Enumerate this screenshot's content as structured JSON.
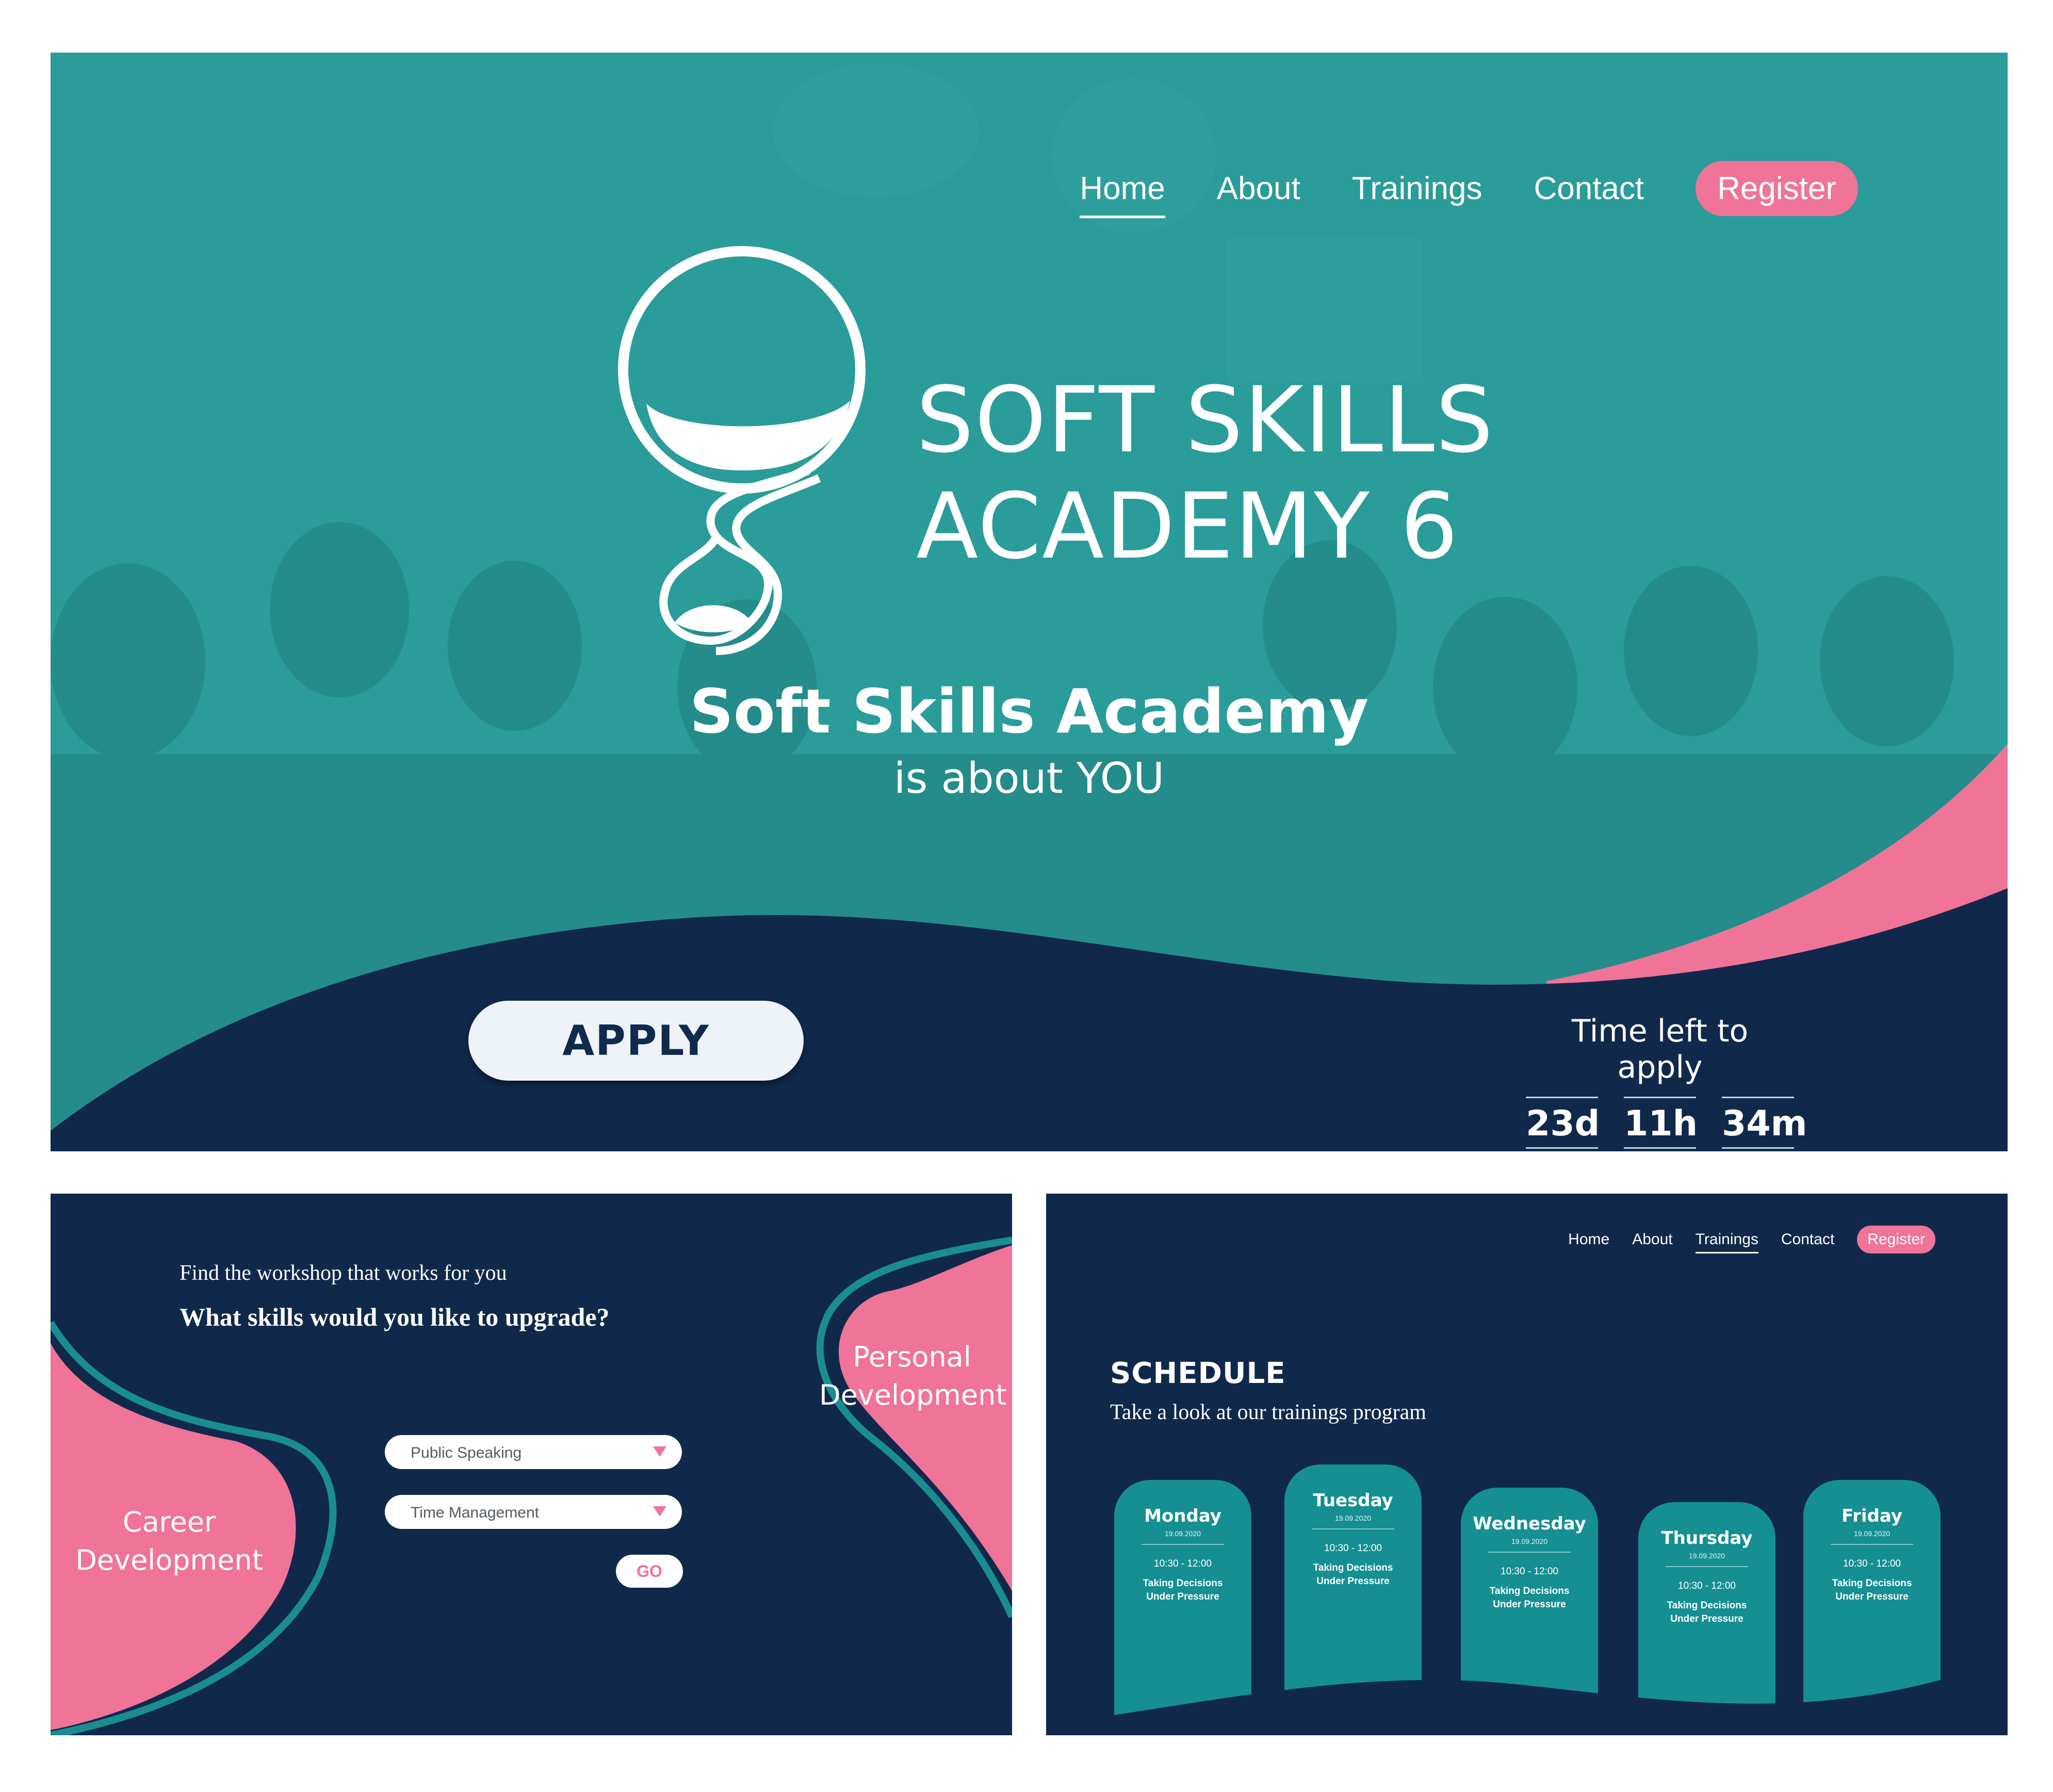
{
  "hero": {
    "nav": [
      {
        "label": "Home"
      },
      {
        "label": "About"
      },
      {
        "label": "Trainings"
      },
      {
        "label": "Contact"
      },
      {
        "label": "Register"
      }
    ],
    "logo_line1": "SOFT SKILLS",
    "logo_line2": "ACADEMY 6",
    "title": "Soft Skills Academy",
    "subtitle": "is about YOU",
    "apply_label": "APPLY",
    "countdown": {
      "label": "Time left to apply",
      "days": "23d",
      "hours": "11h",
      "minutes": "34m"
    }
  },
  "workshop": {
    "intro": "Find the workshop that works for you",
    "question": "What skills would you like to upgrade?",
    "career_label": "Career Development",
    "personal_label": "Personal Development",
    "select1": "Public Speaking",
    "select2": "Time Management",
    "go_label": "GO"
  },
  "schedule": {
    "nav": [
      {
        "label": "Home"
      },
      {
        "label": "About"
      },
      {
        "label": "Trainings"
      },
      {
        "label": "Contact"
      },
      {
        "label": "Register"
      }
    ],
    "title": "SCHEDULE",
    "subtitle": "Take a look at our trainings program",
    "days": [
      {
        "name": "Monday",
        "date": "19.09.2020",
        "time": "10:30 - 12:00",
        "topic": "Taking Decisions Under Pressure"
      },
      {
        "name": "Tuesday",
        "date": "19.09.2020",
        "time": "10:30 - 12:00",
        "topic": "Taking Decisions Under Pressure"
      },
      {
        "name": "Wednesday",
        "date": "19.09.2020",
        "time": "10:30 - 12:00",
        "topic": "Taking Decisions Under Pressure"
      },
      {
        "name": "Thursday",
        "date": "19.09.2020",
        "time": "10:30 - 12:00",
        "topic": "Taking Decisions Under Pressure"
      },
      {
        "name": "Friday",
        "date": "19.09.2020",
        "time": "10:30 - 12:00",
        "topic": "Taking Decisions Under Pressure"
      }
    ]
  },
  "colors": {
    "teal": "#2a9c9a",
    "navy": "#10294b",
    "pink": "#f07398",
    "card_teal": "#158f92",
    "white": "#ffffff"
  }
}
